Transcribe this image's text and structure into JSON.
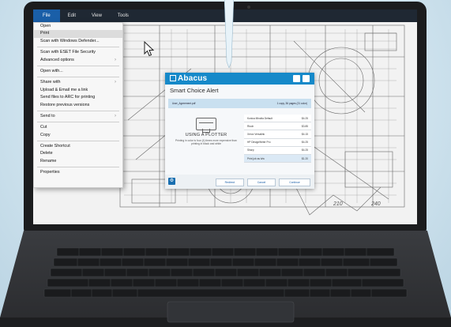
{
  "menubar": {
    "tabs": [
      "File",
      "Edit",
      "View",
      "Tools"
    ]
  },
  "file_menu": {
    "items": [
      {
        "label": "Open"
      },
      {
        "label": "Print"
      },
      {
        "label": "Scan with Windows Defender..."
      },
      {
        "label": "Scan with ESET File Security"
      },
      {
        "label": "Advanced options"
      },
      {
        "label": "Open with..."
      },
      {
        "label": "Share with"
      },
      {
        "label": "Upload & Email me a link"
      },
      {
        "label": "Send files to ARC for printing"
      },
      {
        "label": "Restore previous versions"
      },
      {
        "label": "Send to"
      },
      {
        "label": "Cut"
      },
      {
        "label": "Copy"
      },
      {
        "label": "Create Shortcut"
      },
      {
        "label": "Delete"
      },
      {
        "label": "Rename"
      },
      {
        "label": "Properties"
      }
    ]
  },
  "dialog": {
    "brand": "Abacus",
    "title": "Smart Choice Alert",
    "job_name": "User_Agreement.pdf",
    "job_info": "1 copy, 36 pages (21 color)",
    "plot_heading": "USING A PLOTTER",
    "plot_desc": "Printing in color is four (4) times more expensive than printing in black and white",
    "options": [
      {
        "label": "Konica Minolta Default",
        "price": "$4.25"
      },
      {
        "label": "Ricoh",
        "price": "$3.85"
      },
      {
        "label": "Xerox Versalink",
        "price": "$4.15"
      },
      {
        "label": "HP DesignWriter Pro",
        "price": "$4.25"
      },
      {
        "label": "Sharp",
        "price": "$4.25"
      },
      {
        "label": "Print job as b/w",
        "price": "$1.20"
      }
    ],
    "buttons": {
      "redirect": "Redirect",
      "cancel": "Cancel",
      "continue": "Continue"
    }
  },
  "colors": {
    "accent": "#1689c9",
    "menu_active": "#1a5fa8",
    "menubar": "#1f2833"
  }
}
